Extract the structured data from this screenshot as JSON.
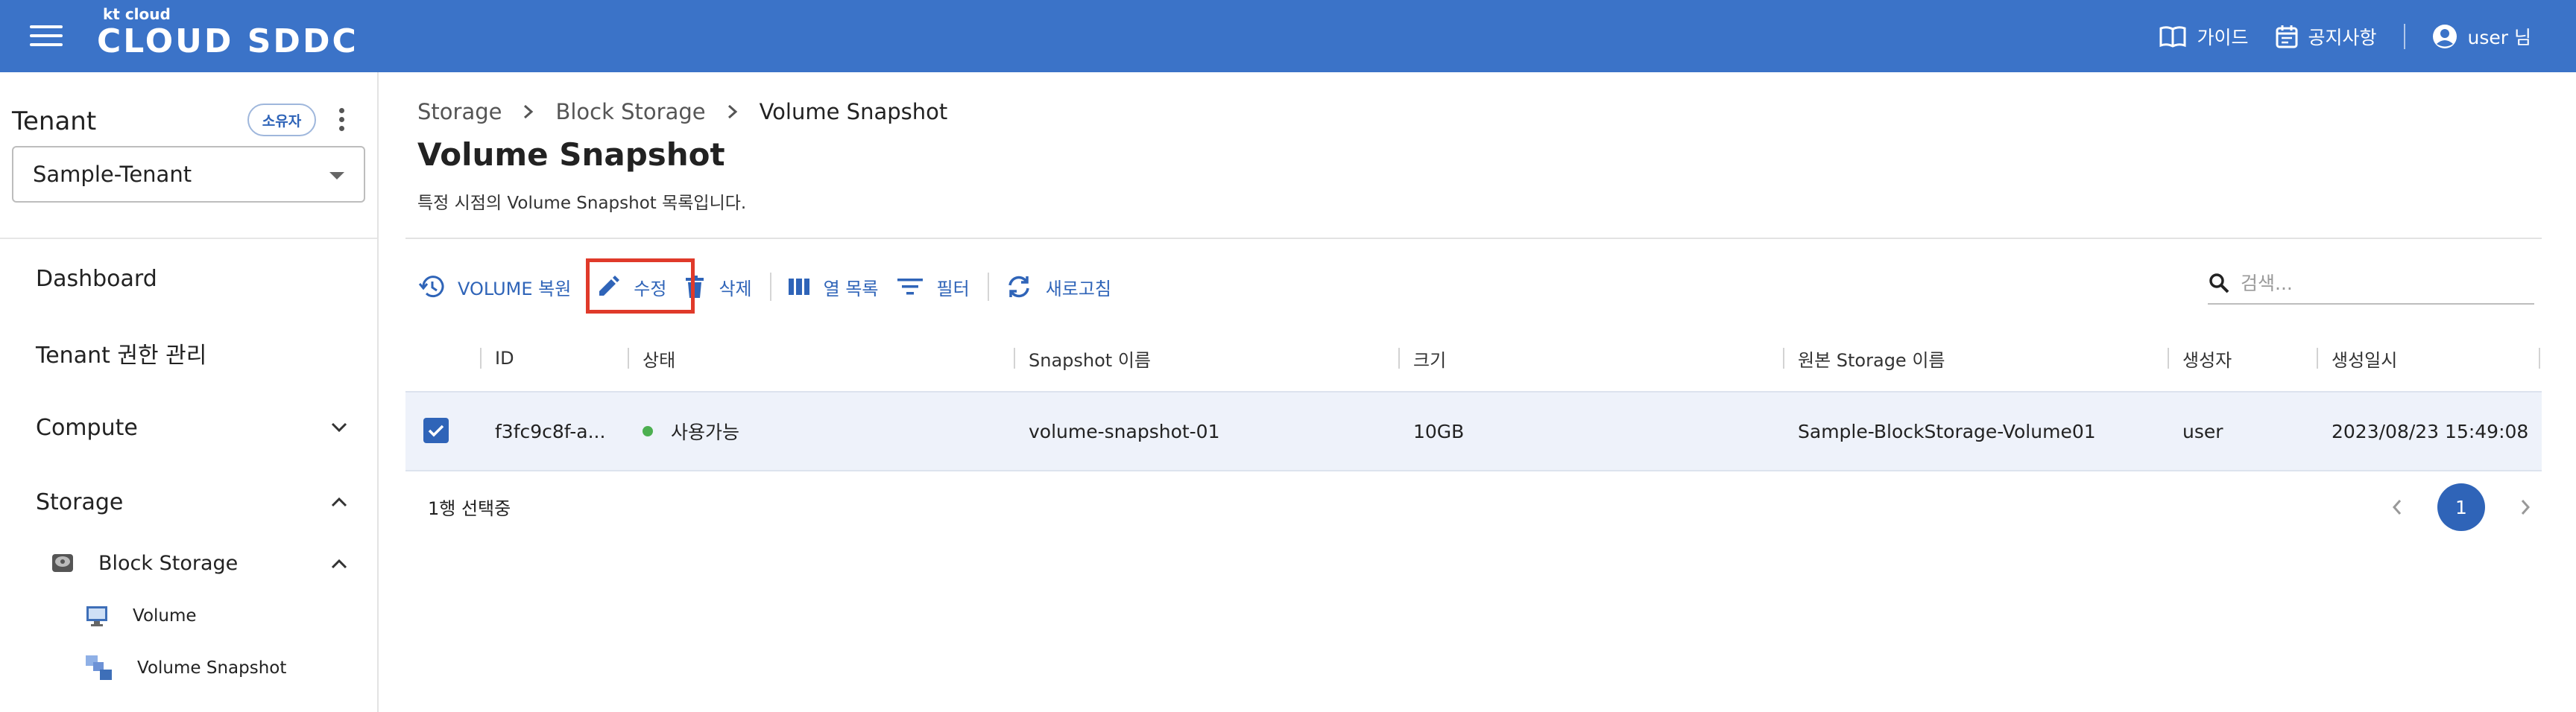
{
  "header": {
    "logo_small": "kt cloud",
    "logo_big": "CLOUD SDDC",
    "guide_label": "가이드",
    "notice_label": "공지사항",
    "user_label": "user 님"
  },
  "sidebar": {
    "tenant_title": "Tenant",
    "owner_badge": "소유자",
    "tenant_selected": "Sample-Tenant",
    "nav": {
      "dashboard": "Dashboard",
      "tenant_auth": "Tenant 권한 관리",
      "compute": "Compute",
      "storage": "Storage",
      "block_storage": "Block Storage",
      "volume": "Volume",
      "volume_snapshot": "Volume Snapshot"
    }
  },
  "breadcrumb": [
    "Storage",
    "Block Storage",
    "Volume Snapshot"
  ],
  "page": {
    "title": "Volume Snapshot",
    "description": "특정 시점의 Volume Snapshot 목록입니다."
  },
  "toolbar": {
    "restore": "VOLUME 복원",
    "edit": "수정",
    "delete": "삭제",
    "columns": "열 목록",
    "filter": "필터",
    "refresh": "새로고침"
  },
  "search": {
    "placeholder": "검색..."
  },
  "table": {
    "headers": [
      "ID",
      "상태",
      "Snapshot 이름",
      "크기",
      "원본 Storage 이름",
      "생성자",
      "생성일시"
    ],
    "rows": [
      {
        "id": "f3fc9c8f-a...",
        "status": "사용가능",
        "snapshot_name": "volume-snapshot-01",
        "size": "10GB",
        "source_storage": "Sample-BlockStorage-Volume01",
        "creator": "user",
        "created_at": "2023/08/23 15:49:08",
        "selected": true
      }
    ],
    "selection_text": "1행 선택중"
  },
  "pagination": {
    "current": "1"
  },
  "colors": {
    "header_bg": "#3b73c8",
    "accent": "#2f64b8",
    "status_available": "#4caf50",
    "highlight": "#e03a2a",
    "selected_row_bg": "#eef2fa"
  }
}
